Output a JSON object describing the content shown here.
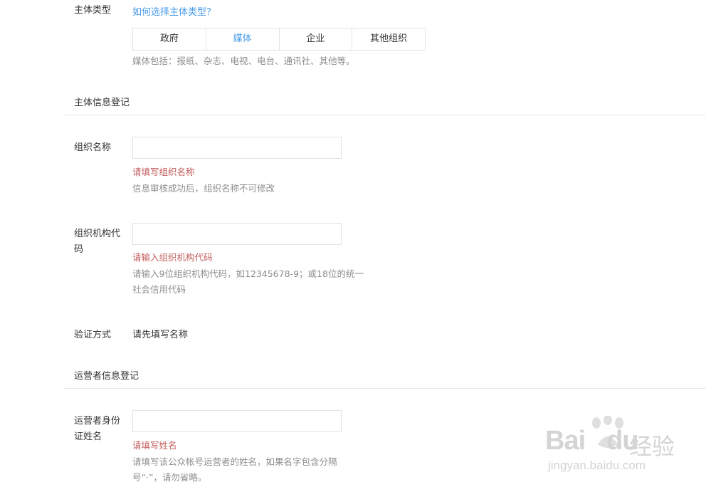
{
  "entity_type": {
    "label": "主体类型",
    "help_link": "如何选择主体类型？",
    "options": [
      "政府",
      "媒体",
      "企业",
      "其他组织"
    ],
    "selected": "媒体",
    "hint": "媒体包括：报纸、杂志、电视、电台、通讯社、其他等。"
  },
  "entity_info_section": {
    "title": "主体信息登记"
  },
  "org_name": {
    "label": "组织名称",
    "value": "",
    "error": "请填写组织名称",
    "hint": "信息审核成功后，组织名称不可修改"
  },
  "org_code": {
    "label_line1": "组织机构代",
    "label_line2": "码",
    "value": "",
    "error": "请输入组织机构代码",
    "hint_line1": "请输入9位组织机构代码，如12345678-9；或18位的统一",
    "hint_line2": "社会信用代码"
  },
  "verify": {
    "label": "验证方式",
    "value": "请先填写名称"
  },
  "operator_section": {
    "title": "运营者信息登记"
  },
  "operator_name": {
    "label_line1": "运营者身份",
    "label_line2": "证姓名",
    "value": "",
    "error": "请填写姓名",
    "hint_line1": "请填写该公众帐号运营者的姓名，如果名字包含分隔",
    "hint_line2": "号“·”，请勿省略。"
  },
  "watermark": {
    "brand": "Bai",
    "brand2": "du",
    "cn": "经验",
    "url": "jingyan.baidu.com"
  }
}
